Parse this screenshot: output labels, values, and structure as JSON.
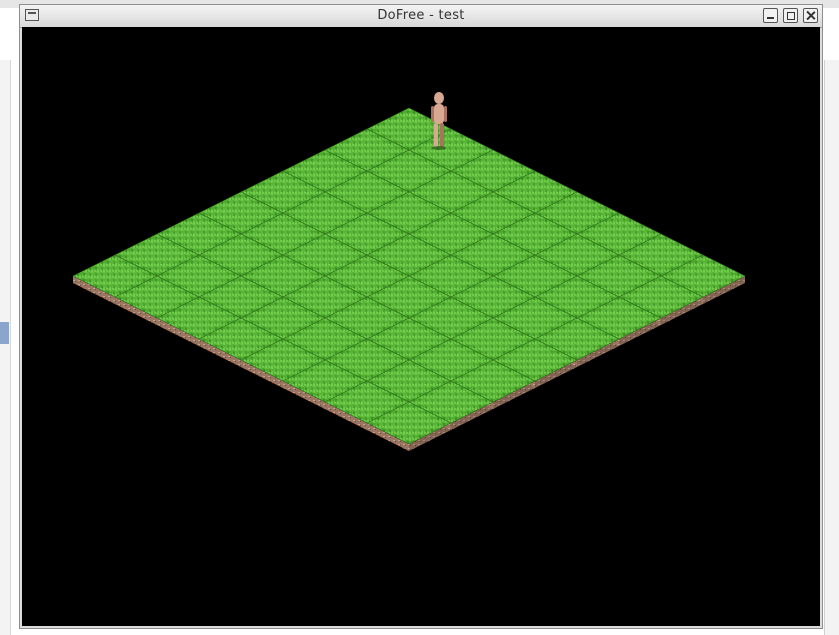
{
  "window": {
    "title": "DoFree - test"
  },
  "game": {
    "map": {
      "rows": 8,
      "cols": 8,
      "tile": "grass"
    },
    "character": {
      "row": 0,
      "col": 1,
      "name": "character"
    },
    "colors": {
      "background": "#000000",
      "grass": "#4fae2e",
      "grass_light": "#6fd04a",
      "soil": "#a8806a"
    }
  }
}
